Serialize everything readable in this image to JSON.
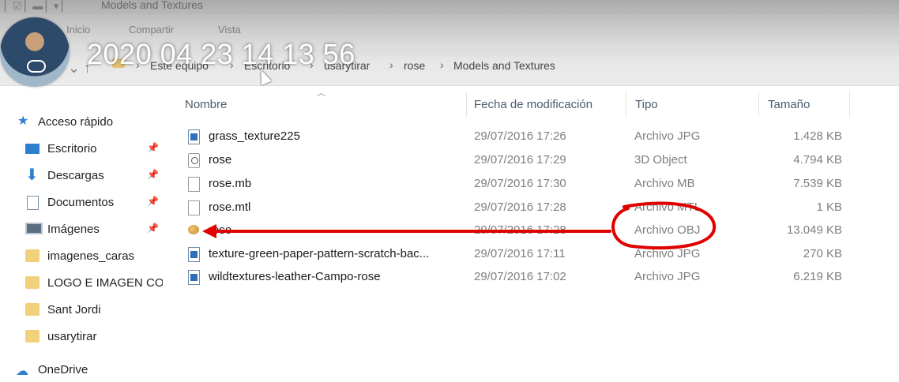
{
  "window": {
    "title": "Models and Textures"
  },
  "ribbon": {
    "tabs": [
      "Inicio",
      "Compartir",
      "Vista"
    ]
  },
  "overlay": {
    "timestamp": "2020 04 23 14 13 56"
  },
  "breadcrumb": [
    "Este equipo",
    "Escritorio",
    "usarytirar",
    "rose",
    "Models and Textures"
  ],
  "sidebar": {
    "items": [
      {
        "label": "Acceso rápido",
        "icon": "star-icon"
      },
      {
        "label": "Escritorio",
        "icon": "desktop-icon",
        "pinned": true
      },
      {
        "label": "Descargas",
        "icon": "download-icon",
        "pinned": true
      },
      {
        "label": "Documentos",
        "icon": "documents-icon",
        "pinned": true
      },
      {
        "label": "Imágenes",
        "icon": "pictures-icon",
        "pinned": true
      },
      {
        "label": "imagenes_caras",
        "icon": "folder-icon"
      },
      {
        "label": "LOGO E IMAGEN CO",
        "icon": "folder-icon"
      },
      {
        "label": "Sant Jordi",
        "icon": "folder-icon"
      },
      {
        "label": "usarytirar",
        "icon": "folder-icon"
      },
      {
        "label": "OneDrive",
        "icon": "onedrive-icon"
      }
    ]
  },
  "columns": {
    "name": "Nombre",
    "date": "Fecha de modificación",
    "type": "Tipo",
    "size": "Tamaño"
  },
  "files": [
    {
      "name": "grass_texture225",
      "date": "29/07/2016 17:26",
      "type": "Archivo JPG",
      "size": "1.428 KB",
      "icon": "jpg-file-icon"
    },
    {
      "name": "rose",
      "date": "29/07/2016 17:29",
      "type": "3D Object",
      "size": "4.794 KB",
      "icon": "3d-object-icon"
    },
    {
      "name": "rose.mb",
      "date": "29/07/2016 17:30",
      "type": "Archivo MB",
      "size": "7.539 KB",
      "icon": "generic-file-icon"
    },
    {
      "name": "rose.mtl",
      "date": "29/07/2016 17:28",
      "type": "Archivo MTL",
      "size": "1 KB",
      "icon": "generic-file-icon"
    },
    {
      "name": "rose",
      "date": "29/07/2016 17:28",
      "type": "Archivo OBJ",
      "size": "13.049 KB",
      "icon": "obj-file-icon"
    },
    {
      "name": "texture-green-paper-pattern-scratch-bac...",
      "date": "29/07/2016 17:11",
      "type": "Archivo JPG",
      "size": "270 KB",
      "icon": "jpg-file-icon"
    },
    {
      "name": "wildtextures-leather-Campo-rose",
      "date": "29/07/2016 17:02",
      "type": "Archivo JPG",
      "size": "6.219 KB",
      "icon": "jpg-file-icon"
    }
  ],
  "annotation": {
    "color": "#e00000"
  }
}
